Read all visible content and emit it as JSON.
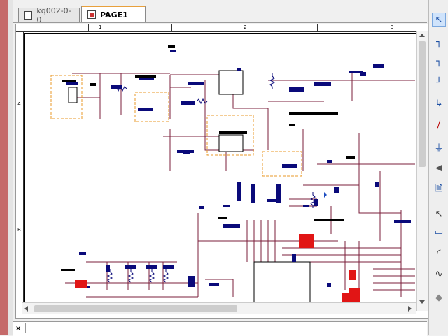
{
  "tabs": [
    {
      "label": "kq002-0-0",
      "icon": "schematic-icon",
      "active": false
    },
    {
      "label": "PAGE1",
      "icon": "page-icon",
      "active": true
    }
  ],
  "ruler": {
    "columns": [
      "1",
      "2",
      "3"
    ],
    "rows": [
      "A",
      "B"
    ]
  },
  "status": {
    "close": "×",
    "text": ""
  },
  "toolbar": {
    "tools": [
      "select-tool",
      "wire-tool",
      "bus-tool",
      "net-tool",
      "part-tool",
      "power-tool",
      "ground-tool",
      "offpage-tool",
      "text-tool",
      "pointer-tool",
      "port-tool",
      "arc-tool",
      "polyline-tool",
      "eraser-tool"
    ]
  },
  "colors": {
    "wire": "#7b1f3b",
    "part": "#0a0a7a",
    "highlight": "#e11515",
    "group": "#e89a28",
    "accent": "#c56a6a"
  }
}
